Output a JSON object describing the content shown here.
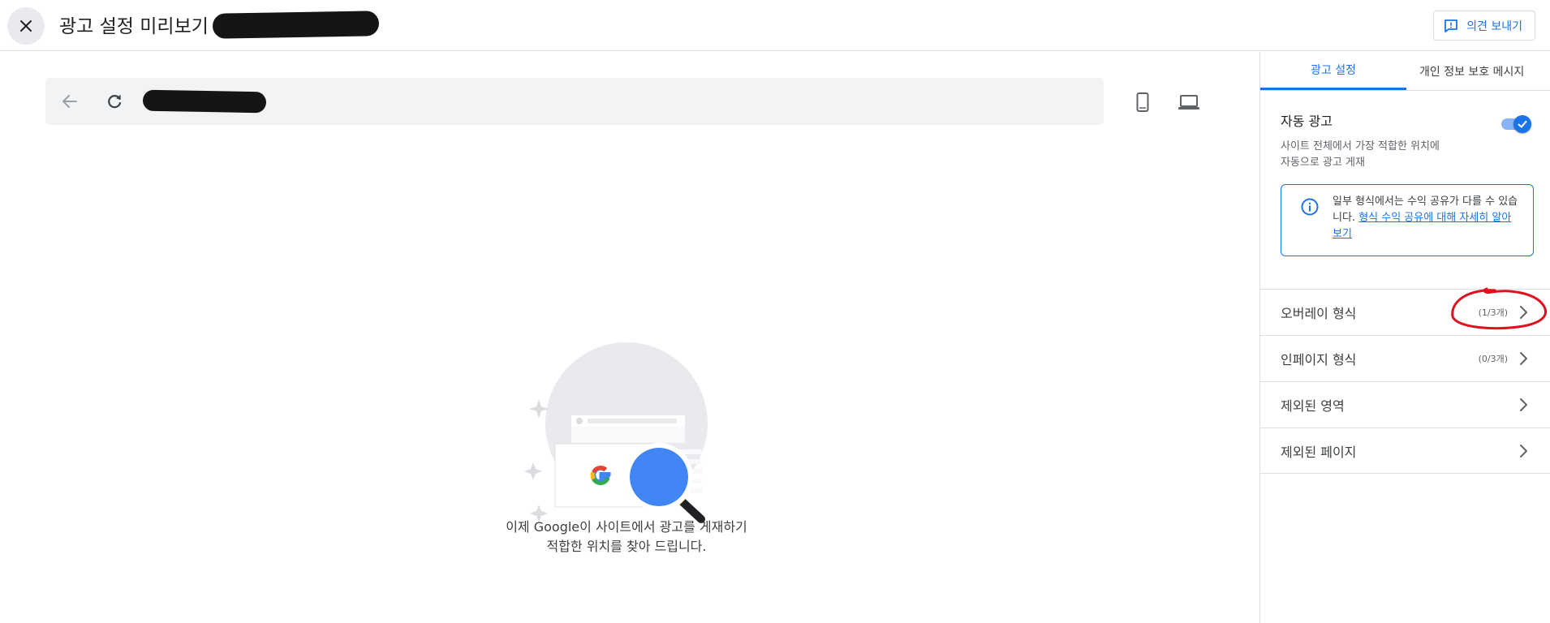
{
  "header": {
    "title": "광고 설정 미리보기",
    "feedback_label": "의견 보내기"
  },
  "icons": {
    "close": "close-icon",
    "feedback": "feedback-icon",
    "back": "arrow-back-icon",
    "reload": "refresh-icon",
    "phone": "smartphone-icon",
    "laptop": "laptop-icon",
    "info": "info-icon",
    "chevron": "chevron-right-icon",
    "toggle_check": "check-icon"
  },
  "preview": {
    "message_line1": "이제 Google이 사이트에서 광고를 게재하기",
    "message_line2": "적합한 위치를 찾아 드립니다."
  },
  "panel": {
    "tabs": [
      {
        "label": "광고 설정",
        "active": true
      },
      {
        "label": "개인 정보 보호 메시지",
        "active": false
      }
    ],
    "auto_ads": {
      "title": "자동 광고",
      "desc_line1": "사이트 전체에서 가장 적합한 위치에",
      "desc_line2": "자동으로 광고 게재",
      "enabled": true
    },
    "info": {
      "text": "일부 형식에서는 수익 공유가 다를 수 있습니다. ",
      "link": "형식 수익 공유에 대해 자세히 알아보기"
    },
    "rows": [
      {
        "label": "오버레이 형식",
        "count": "(1/3개)"
      },
      {
        "label": "인페이지 형식",
        "count": "(0/3개)"
      },
      {
        "label": "제외된 영역",
        "count": ""
      },
      {
        "label": "제외된 페이지",
        "count": ""
      }
    ]
  },
  "colors": {
    "accent": "#1a73e8",
    "annotation": "#e0101e",
    "redaction": "#151515"
  }
}
